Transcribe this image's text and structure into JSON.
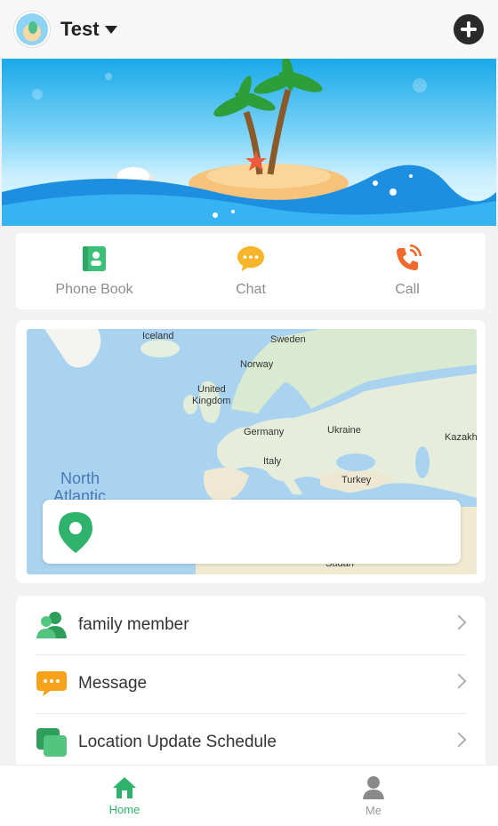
{
  "header": {
    "user_name": "Test",
    "avatar_icon": "avatar-island-icon",
    "add_icon": "plus-circle-icon"
  },
  "quick_actions": [
    {
      "label": "Phone Book",
      "icon": "phone-book-icon",
      "color": "#3cbf79"
    },
    {
      "label": "Chat",
      "icon": "chat-bubble-icon",
      "color": "#f7b52b"
    },
    {
      "label": "Call",
      "icon": "phone-call-icon",
      "color": "#f06a2e"
    }
  ],
  "map": {
    "labels": {
      "iceland": "Iceland",
      "sweden": "Sweden",
      "norway": "Norway",
      "uk_line1": "United",
      "uk_line2": "Kingdom",
      "germany": "Germany",
      "ukraine": "Ukraine",
      "kazakh": "Kazakh",
      "italy": "Italy",
      "turkey": "Turkey",
      "north": "North",
      "atlantic": "Atlantic",
      "sudan": "Sudan"
    },
    "location_icon": "location-pin-icon"
  },
  "menu": [
    {
      "label": "family member",
      "icon": "family-icon",
      "color": "#3cbf79"
    },
    {
      "label": "Message",
      "icon": "message-icon",
      "color": "#f7a21b"
    },
    {
      "label": "Location Update Schedule",
      "icon": "schedule-icon",
      "color": "#3cbf79"
    }
  ],
  "bottom_nav": [
    {
      "label": "Home",
      "icon": "home-icon",
      "active": true,
      "color": "#3cbf79"
    },
    {
      "label": "Me",
      "icon": "person-icon",
      "active": false,
      "color": "#999999"
    }
  ]
}
